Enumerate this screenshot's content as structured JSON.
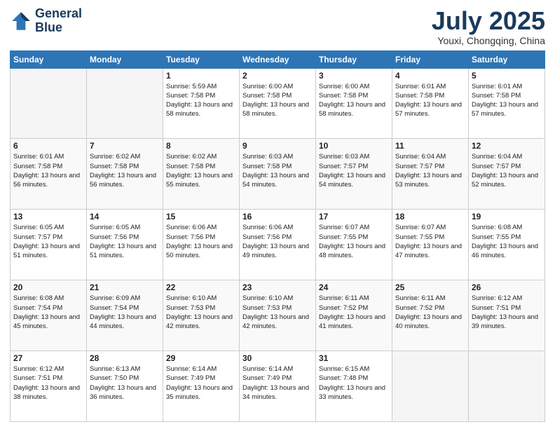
{
  "header": {
    "logo_line1": "General",
    "logo_line2": "Blue",
    "month": "July 2025",
    "location": "Youxi, Chongqing, China"
  },
  "weekdays": [
    "Sunday",
    "Monday",
    "Tuesday",
    "Wednesday",
    "Thursday",
    "Friday",
    "Saturday"
  ],
  "weeks": [
    [
      {
        "day": "",
        "empty": true
      },
      {
        "day": "",
        "empty": true
      },
      {
        "day": "1",
        "sunrise": "Sunrise: 5:59 AM",
        "sunset": "Sunset: 7:58 PM",
        "daylight": "Daylight: 13 hours and 58 minutes."
      },
      {
        "day": "2",
        "sunrise": "Sunrise: 6:00 AM",
        "sunset": "Sunset: 7:58 PM",
        "daylight": "Daylight: 13 hours and 58 minutes."
      },
      {
        "day": "3",
        "sunrise": "Sunrise: 6:00 AM",
        "sunset": "Sunset: 7:58 PM",
        "daylight": "Daylight: 13 hours and 58 minutes."
      },
      {
        "day": "4",
        "sunrise": "Sunrise: 6:01 AM",
        "sunset": "Sunset: 7:58 PM",
        "daylight": "Daylight: 13 hours and 57 minutes."
      },
      {
        "day": "5",
        "sunrise": "Sunrise: 6:01 AM",
        "sunset": "Sunset: 7:58 PM",
        "daylight": "Daylight: 13 hours and 57 minutes."
      }
    ],
    [
      {
        "day": "6",
        "sunrise": "Sunrise: 6:01 AM",
        "sunset": "Sunset: 7:58 PM",
        "daylight": "Daylight: 13 hours and 56 minutes."
      },
      {
        "day": "7",
        "sunrise": "Sunrise: 6:02 AM",
        "sunset": "Sunset: 7:58 PM",
        "daylight": "Daylight: 13 hours and 56 minutes."
      },
      {
        "day": "8",
        "sunrise": "Sunrise: 6:02 AM",
        "sunset": "Sunset: 7:58 PM",
        "daylight": "Daylight: 13 hours and 55 minutes."
      },
      {
        "day": "9",
        "sunrise": "Sunrise: 6:03 AM",
        "sunset": "Sunset: 7:58 PM",
        "daylight": "Daylight: 13 hours and 54 minutes."
      },
      {
        "day": "10",
        "sunrise": "Sunrise: 6:03 AM",
        "sunset": "Sunset: 7:57 PM",
        "daylight": "Daylight: 13 hours and 54 minutes."
      },
      {
        "day": "11",
        "sunrise": "Sunrise: 6:04 AM",
        "sunset": "Sunset: 7:57 PM",
        "daylight": "Daylight: 13 hours and 53 minutes."
      },
      {
        "day": "12",
        "sunrise": "Sunrise: 6:04 AM",
        "sunset": "Sunset: 7:57 PM",
        "daylight": "Daylight: 13 hours and 52 minutes."
      }
    ],
    [
      {
        "day": "13",
        "sunrise": "Sunrise: 6:05 AM",
        "sunset": "Sunset: 7:57 PM",
        "daylight": "Daylight: 13 hours and 51 minutes."
      },
      {
        "day": "14",
        "sunrise": "Sunrise: 6:05 AM",
        "sunset": "Sunset: 7:56 PM",
        "daylight": "Daylight: 13 hours and 51 minutes."
      },
      {
        "day": "15",
        "sunrise": "Sunrise: 6:06 AM",
        "sunset": "Sunset: 7:56 PM",
        "daylight": "Daylight: 13 hours and 50 minutes."
      },
      {
        "day": "16",
        "sunrise": "Sunrise: 6:06 AM",
        "sunset": "Sunset: 7:56 PM",
        "daylight": "Daylight: 13 hours and 49 minutes."
      },
      {
        "day": "17",
        "sunrise": "Sunrise: 6:07 AM",
        "sunset": "Sunset: 7:55 PM",
        "daylight": "Daylight: 13 hours and 48 minutes."
      },
      {
        "day": "18",
        "sunrise": "Sunrise: 6:07 AM",
        "sunset": "Sunset: 7:55 PM",
        "daylight": "Daylight: 13 hours and 47 minutes."
      },
      {
        "day": "19",
        "sunrise": "Sunrise: 6:08 AM",
        "sunset": "Sunset: 7:55 PM",
        "daylight": "Daylight: 13 hours and 46 minutes."
      }
    ],
    [
      {
        "day": "20",
        "sunrise": "Sunrise: 6:08 AM",
        "sunset": "Sunset: 7:54 PM",
        "daylight": "Daylight: 13 hours and 45 minutes."
      },
      {
        "day": "21",
        "sunrise": "Sunrise: 6:09 AM",
        "sunset": "Sunset: 7:54 PM",
        "daylight": "Daylight: 13 hours and 44 minutes."
      },
      {
        "day": "22",
        "sunrise": "Sunrise: 6:10 AM",
        "sunset": "Sunset: 7:53 PM",
        "daylight": "Daylight: 13 hours and 42 minutes."
      },
      {
        "day": "23",
        "sunrise": "Sunrise: 6:10 AM",
        "sunset": "Sunset: 7:53 PM",
        "daylight": "Daylight: 13 hours and 42 minutes."
      },
      {
        "day": "24",
        "sunrise": "Sunrise: 6:11 AM",
        "sunset": "Sunset: 7:52 PM",
        "daylight": "Daylight: 13 hours and 41 minutes."
      },
      {
        "day": "25",
        "sunrise": "Sunrise: 6:11 AM",
        "sunset": "Sunset: 7:52 PM",
        "daylight": "Daylight: 13 hours and 40 minutes."
      },
      {
        "day": "26",
        "sunrise": "Sunrise: 6:12 AM",
        "sunset": "Sunset: 7:51 PM",
        "daylight": "Daylight: 13 hours and 39 minutes."
      }
    ],
    [
      {
        "day": "27",
        "sunrise": "Sunrise: 6:12 AM",
        "sunset": "Sunset: 7:51 PM",
        "daylight": "Daylight: 13 hours and 38 minutes."
      },
      {
        "day": "28",
        "sunrise": "Sunrise: 6:13 AM",
        "sunset": "Sunset: 7:50 PM",
        "daylight": "Daylight: 13 hours and 36 minutes."
      },
      {
        "day": "29",
        "sunrise": "Sunrise: 6:14 AM",
        "sunset": "Sunset: 7:49 PM",
        "daylight": "Daylight: 13 hours and 35 minutes."
      },
      {
        "day": "30",
        "sunrise": "Sunrise: 6:14 AM",
        "sunset": "Sunset: 7:49 PM",
        "daylight": "Daylight: 13 hours and 34 minutes."
      },
      {
        "day": "31",
        "sunrise": "Sunrise: 6:15 AM",
        "sunset": "Sunset: 7:48 PM",
        "daylight": "Daylight: 13 hours and 33 minutes."
      },
      {
        "day": "",
        "empty": true
      },
      {
        "day": "",
        "empty": true
      }
    ]
  ]
}
